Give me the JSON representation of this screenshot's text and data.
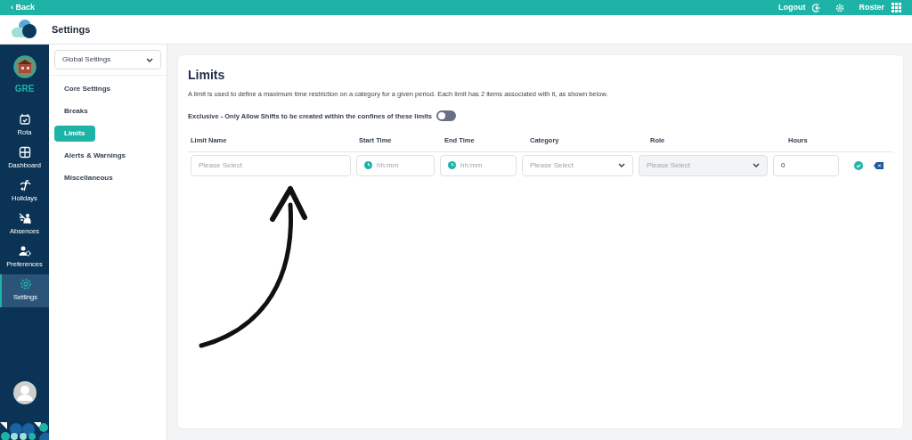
{
  "top_bar": {
    "back": "‹ Back",
    "logout": "Logout",
    "roster": "Roster"
  },
  "header": {
    "title": "Settings"
  },
  "rail": {
    "team": "GRE",
    "items": [
      {
        "label": "Rota",
        "kind": "calendar",
        "selected": false
      },
      {
        "label": "Dashboard",
        "kind": "grid",
        "selected": false
      },
      {
        "label": "Holidays",
        "kind": "palm",
        "selected": false
      },
      {
        "label": "Absences",
        "kind": "absence",
        "selected": false
      },
      {
        "label": "Preferences",
        "kind": "preferences",
        "selected": false
      },
      {
        "label": "Settings",
        "kind": "settings",
        "selected": true
      }
    ]
  },
  "submenu": {
    "dropdown": "Global Settings",
    "items": [
      {
        "label": "Core Settings",
        "selected": false
      },
      {
        "label": "Breaks",
        "selected": false
      },
      {
        "label": "Limits",
        "selected": true
      },
      {
        "label": "Alerts & Warnings",
        "selected": false
      },
      {
        "label": "Miscellaneous",
        "selected": false
      }
    ]
  },
  "limits": {
    "title": "Limits",
    "description": "A limit is used to define a maximum time restriction on a category for a given period. Each limit has 2 items associated with it, as shown below.",
    "exclusive": {
      "label": "Exclusive - Only Allow Shifts to be created within the confines of these limits",
      "on": false
    },
    "columns": [
      "Limit Name",
      "Start Time",
      "End Time",
      "Category",
      "Role",
      "Hours"
    ],
    "row": [
      {
        "kind": "text",
        "placeholder": "Please Select"
      },
      {
        "kind": "time",
        "placeholder": "hh:mm"
      },
      {
        "kind": "time",
        "placeholder": "hh:mm"
      },
      {
        "kind": "select",
        "placeholder": "Please Select",
        "disabled": false
      },
      {
        "kind": "select",
        "placeholder": "Please Select",
        "disabled": true
      },
      {
        "kind": "number",
        "value": "0"
      }
    ]
  }
}
